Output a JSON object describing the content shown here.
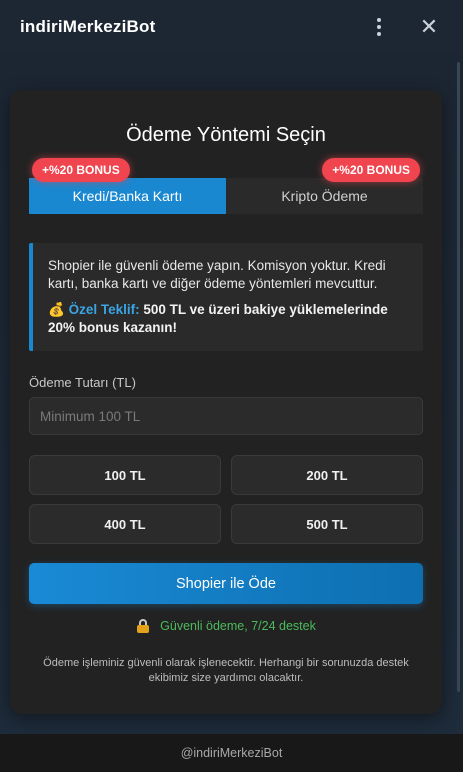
{
  "header": {
    "title": "indiriMerkeziBot"
  },
  "card": {
    "title": "Ödeme Yöntemi Seçin",
    "bonus_left": "+%20 BONUS",
    "bonus_right": "+%20 BONUS",
    "tabs": [
      {
        "label": "Kredi/Banka Kartı",
        "active": true
      },
      {
        "label": "Kripto Ödeme",
        "active": false
      }
    ],
    "info": {
      "text": "Shopier ile güvenli ödeme yapın. Komisyon yoktur. Kredi kartı, banka kartı ve diğer ödeme yöntemleri mevcuttur.",
      "offer_emoji": "💰",
      "offer_label": "Özel Teklif:",
      "offer_text_1": " 500 TL ve üzeri bakiye yüklemelerinde ",
      "offer_bold": "20%",
      "offer_text_2": " bonus kazanın!"
    },
    "amount": {
      "label": "Ödeme Tutarı (TL)",
      "placeholder": "Minimum 100 TL",
      "value": ""
    },
    "quick_amounts": [
      "100 TL",
      "200 TL",
      "400 TL",
      "500 TL"
    ],
    "pay_button": "Shopier ile Öde",
    "secure_text": "Güvenli ödeme, 7/24 destek",
    "footnote": "Ödeme işleminiz güvenli olarak işlenecektir. Herhangi bir sorunuzda destek ekibimiz size yardımcı olacaktır."
  },
  "footer": {
    "handle": "@indiriMerkeziBot"
  },
  "colors": {
    "accent": "#1a88d0",
    "bonus": "#f0444f",
    "success": "#4cba5c"
  },
  "icons": {
    "menu": "more-vertical-icon",
    "close": "close-icon",
    "lock": "lock-icon"
  }
}
